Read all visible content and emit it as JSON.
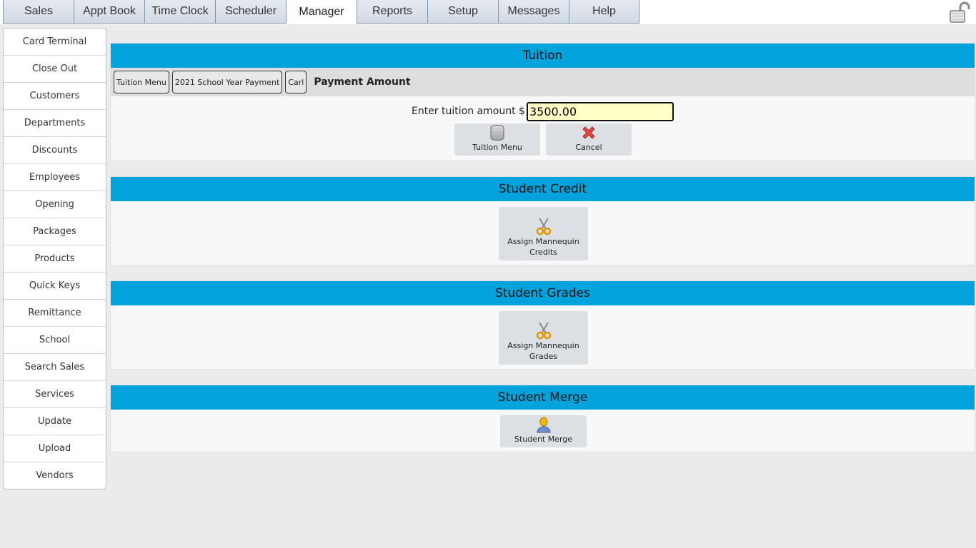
{
  "top_tabs": [
    "Sales",
    "Appt Book",
    "Time Clock",
    "Scheduler",
    "Manager",
    "Reports",
    "Setup",
    "Messages",
    "Help"
  ],
  "active_tab": "Manager",
  "sidebar": {
    "items": [
      "Card Terminal",
      "Close Out",
      "Customers",
      "Departments",
      "Discounts",
      "Employees",
      "Opening",
      "Packages",
      "Products",
      "Quick Keys",
      "Remittance",
      "School",
      "Search Sales",
      "Services",
      "Update",
      "Upload",
      "Vendors"
    ]
  },
  "tuition": {
    "title": "Tuition",
    "breadcrumbs": [
      "Tuition Menu",
      "2021 School Year Payment",
      "Carl"
    ],
    "section_title": "Payment Amount",
    "amount_label": "Enter tuition amount $",
    "amount_value": "3500.00",
    "menu_button": "Tuition Menu",
    "cancel_button": "Cancel"
  },
  "student_credit": {
    "title": "Student Credit",
    "button_line1": "Assign Mannequin",
    "button_line2": "Credits"
  },
  "student_grades": {
    "title": "Student Grades",
    "button_line1": "Assign Mannequin",
    "button_line2": "Grades"
  },
  "student_merge": {
    "title": "Student Merge",
    "button": "Student Merge"
  },
  "colors": {
    "header_blue": "#00a3db",
    "input_yellow": "#ffffc6",
    "button_gray": "#dcdfe4"
  },
  "icons": {
    "lock": "unlocked-padlock-icon",
    "tuition_menu": "database-icon",
    "cancel": "red-x-icon",
    "mannequin": "scissors-icon",
    "merge": "user-icon"
  }
}
